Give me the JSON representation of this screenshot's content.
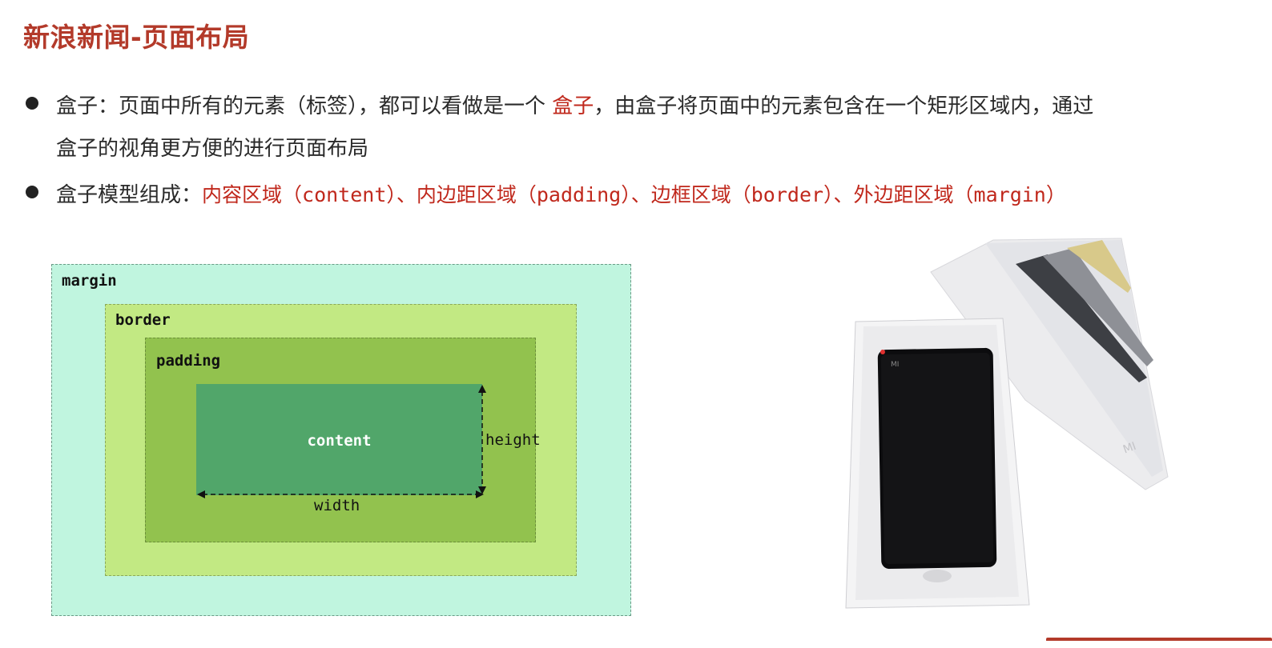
{
  "title": "新浪新闻-页面布局",
  "bullets": [
    {
      "line1_prefix": "盒子：页面中所有的元素（标签），都可以看做是一个 ",
      "line1_highlight": "盒子",
      "line1_suffix": "，由盒子将页面中的元素包含在一个矩形区域内，通过",
      "line2": "盒子的视角更方便的进行页面布局"
    },
    {
      "prefix": "盒子模型组成：",
      "highlight": "内容区域（content）、内边距区域（padding）、边框区域（border）、外边距区域（margin）"
    }
  ],
  "diagram": {
    "margin_label": "margin",
    "border_label": "border",
    "padding_label": "padding",
    "content_label": "content",
    "width_label": "width",
    "height_label": "height"
  },
  "photo": {
    "logo_text": "MI"
  },
  "colors": {
    "title": "#b33a2a",
    "highlight": "#c0281c",
    "margin": "#c0f5df",
    "border": "#c2e983",
    "padding": "#92c24e",
    "content": "#51a66a"
  }
}
